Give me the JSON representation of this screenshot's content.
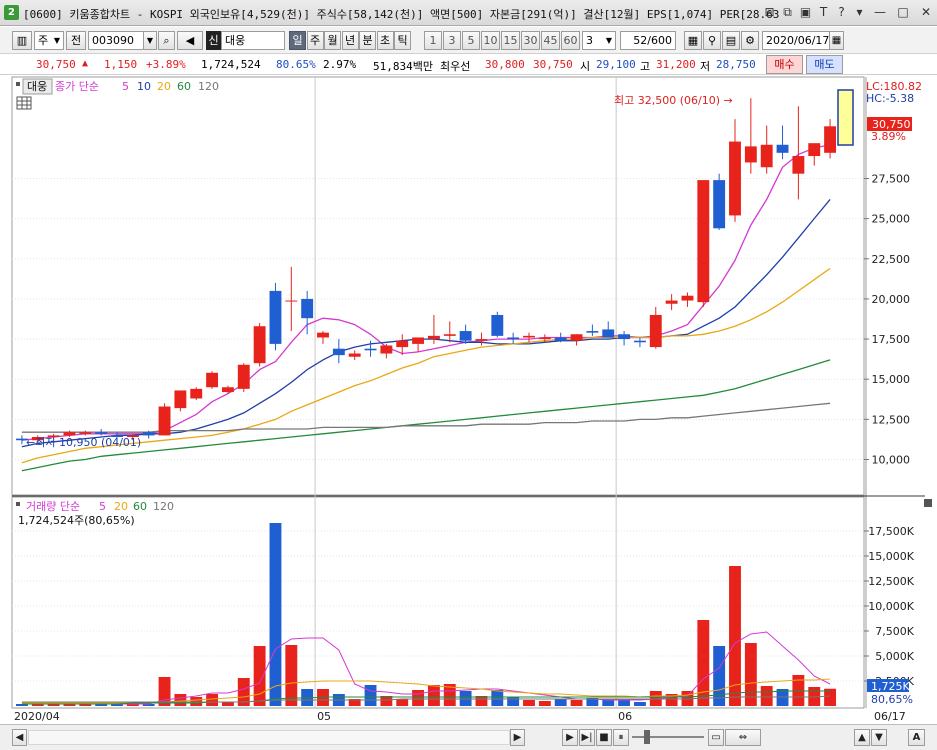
{
  "window": {
    "badge": "2",
    "title": "[0600] 키움종합차트 - KOSPI 외국인보유[4,529(천)] 주식수[58,142(천)] 액면[500] 자본금[291(억)] 결산[12월] EPS[1,074] PER[28.63",
    "icons": [
      "restore-icon",
      "pin-icon",
      "save-icon",
      "font-icon",
      "help-icon",
      "menu-icon",
      "minimize-icon",
      "maximize-icon",
      "close-icon"
    ],
    "glyphs": [
      "⊟",
      "⧉",
      "▣",
      "T",
      "?",
      "▾",
      "—",
      "□",
      "✕"
    ]
  },
  "toolbar": {
    "layout_icon": "▥",
    "type": "주",
    "period_button": "전",
    "code": "003090",
    "search_icon": "⌕",
    "sound_icon": "◀",
    "credit_badge": "신",
    "name": "대웅",
    "intervals": [
      "일",
      "주",
      "월",
      "년",
      "분",
      "초",
      "틱"
    ],
    "selected_interval": "일",
    "numbers": [
      "1",
      "3",
      "5",
      "10",
      "15",
      "30",
      "45",
      "60"
    ],
    "count": "3",
    "count_arrow": "▼",
    "range": "52",
    "range_total": "/600",
    "tool_icons": [
      "▦",
      "⚲",
      "▤",
      "⚙"
    ],
    "date": "2020/06/17",
    "calendar_icon": "▦"
  },
  "quote": {
    "price": "30,750",
    "arrow": "▲",
    "change": "1,150",
    "pct": "+3.89%",
    "volume": "1,724,524",
    "vol_ratio": "80.65%",
    "turnover": "2.97%",
    "amount": "51,834백만",
    "priority_label": "최우선",
    "ask": "30,800",
    "bid": "30,750",
    "open_label": "시",
    "open": "29,100",
    "high_label": "고",
    "high": "31,200",
    "low_label": "저",
    "low": "28,750",
    "buy": "매수",
    "sell": "매도"
  },
  "colors": {
    "up": "#e8231b",
    "down": "#1f5fd1",
    "ma5": "#d33ad3",
    "ma10": "#1f3fa8",
    "ma20": "#e8a814",
    "ma60": "#228b3c",
    "ma120": "#777777"
  },
  "chart_data": [
    {
      "type": "candlestick",
      "legend": {
        "stock": "대웅",
        "indicator": "종가 단순",
        "periods": [
          "5",
          "10",
          "20",
          "60",
          "120"
        ]
      },
      "ymin": 8500,
      "ymax": 18500,
      "yticks": [
        10000,
        12500,
        15000,
        17500,
        20000,
        22500,
        25000,
        27500
      ],
      "ytick_labels": [
        "10,000",
        "12,500",
        "15,000",
        "17,500",
        "20,000",
        "22,500",
        "25,000",
        "27,500"
      ],
      "lc_label": "LC:180.82",
      "hc_label": "HC:-5.38",
      "current_label": "30,750",
      "current_pct": "3.89%",
      "max_annotation": "최고 32,500 (06/10) →",
      "min_annotation": "←최저 10,950 (04/01)",
      "x_labels": [
        "2020/04",
        "05",
        "06",
        "06/17"
      ],
      "candles": [
        [
          11300,
          11500,
          10950,
          11200
        ],
        [
          11200,
          11500,
          11000,
          11400
        ],
        [
          11400,
          11600,
          11300,
          11500
        ],
        [
          11500,
          11800,
          11400,
          11700
        ],
        [
          11600,
          11800,
          11500,
          11700
        ],
        [
          11700,
          11900,
          11500,
          11600
        ],
        [
          11500,
          11700,
          11300,
          11400
        ],
        [
          11400,
          11600,
          11200,
          11500
        ],
        [
          11700,
          11800,
          11300,
          11500
        ],
        [
          11500,
          13500,
          11500,
          13300
        ],
        [
          13200,
          14200,
          13000,
          14300
        ],
        [
          13800,
          14500,
          13700,
          14400
        ],
        [
          14500,
          15500,
          14400,
          15400
        ],
        [
          14200,
          14600,
          14100,
          14500
        ],
        [
          14400,
          16000,
          14200,
          15900
        ],
        [
          16000,
          18500,
          15800,
          18300
        ],
        [
          20500,
          21000,
          16800,
          17200
        ],
        [
          19900,
          22000,
          18000,
          19900
        ],
        [
          20000,
          20500,
          17800,
          18800
        ],
        [
          17600,
          18000,
          17200,
          17900
        ],
        [
          16900,
          17500,
          16000,
          16500
        ],
        [
          16400,
          16800,
          16200,
          16600
        ],
        [
          16900,
          17400,
          16400,
          16800
        ],
        [
          16600,
          17200,
          16300,
          17100
        ],
        [
          17000,
          17800,
          16500,
          17400
        ],
        [
          17200,
          17600,
          16700,
          17600
        ],
        [
          17500,
          19000,
          17200,
          17700
        ],
        [
          17700,
          18600,
          17300,
          17800
        ],
        [
          18000,
          18400,
          17200,
          17400
        ],
        [
          17400,
          17900,
          17100,
          17500
        ],
        [
          19000,
          19200,
          17600,
          17700
        ],
        [
          17600,
          17900,
          17200,
          17500
        ],
        [
          17600,
          17900,
          17300,
          17700
        ],
        [
          17500,
          17800,
          17300,
          17600
        ],
        [
          17600,
          17900,
          17300,
          17400
        ],
        [
          17400,
          17800,
          17100,
          17800
        ],
        [
          18000,
          18400,
          17700,
          17900
        ],
        [
          18100,
          18600,
          17700,
          17600
        ],
        [
          17800,
          18000,
          17100,
          17500
        ],
        [
          17400,
          17600,
          17000,
          17300
        ],
        [
          17000,
          19500,
          16900,
          19000
        ],
        [
          19700,
          20300,
          19300,
          19900
        ],
        [
          19900,
          20400,
          19500,
          20200
        ],
        [
          19800,
          26800,
          19500,
          27400
        ],
        [
          27400,
          27800,
          24300,
          24400
        ],
        [
          25200,
          31200,
          24800,
          29800
        ],
        [
          28500,
          32500,
          27800,
          29500
        ],
        [
          28200,
          30800,
          27800,
          29600
        ],
        [
          29600,
          30800,
          28700,
          29100
        ],
        [
          27800,
          32000,
          26200,
          28900
        ],
        [
          28900,
          29600,
          28300,
          29700
        ],
        [
          29100,
          31200,
          28750,
          30750
        ]
      ],
      "series": [
        {
          "name": "5",
          "color": "#d33ad3",
          "values": [
            11200,
            11300,
            11400,
            11500,
            11600,
            11600,
            11600,
            11600,
            11600,
            11800,
            12300,
            12800,
            13600,
            14100,
            14700,
            15600,
            16100,
            17300,
            18400,
            18800,
            18700,
            18400,
            17800,
            17000,
            16600,
            16700,
            16900,
            17100,
            17300,
            17400,
            17500,
            17500,
            17500,
            17600,
            17600,
            17600,
            17600,
            17700,
            17700,
            17600,
            17700,
            18000,
            18400,
            19600,
            20800,
            22400,
            24600,
            26200,
            28200,
            29000,
            29400,
            29600
          ]
        },
        {
          "name": "10",
          "color": "#1f3fa8",
          "values": [
            10800,
            11000,
            11100,
            11200,
            11300,
            11400,
            11500,
            11500,
            11600,
            11600,
            11700,
            11900,
            12200,
            12500,
            12900,
            13500,
            14100,
            14800,
            15600,
            16200,
            16700,
            17000,
            17200,
            17300,
            17400,
            17500,
            17500,
            17400,
            17300,
            17300,
            17200,
            17200,
            17200,
            17300,
            17400,
            17400,
            17500,
            17500,
            17600,
            17600,
            17600,
            17700,
            17800,
            18300,
            18800,
            19500,
            20500,
            21500,
            22600,
            23800,
            25000,
            26200
          ]
        },
        {
          "name": "20",
          "color": "#e8a814",
          "values": [
            9800,
            10100,
            10300,
            10500,
            10700,
            10800,
            10900,
            11000,
            11100,
            11200,
            11300,
            11400,
            11500,
            11700,
            11900,
            12200,
            12500,
            13000,
            13400,
            13800,
            14200,
            14600,
            14900,
            15300,
            15700,
            16000,
            16400,
            16600,
            16800,
            17000,
            17100,
            17200,
            17300,
            17400,
            17500,
            17500,
            17600,
            17600,
            17600,
            17600,
            17600,
            17700,
            17700,
            17800,
            18000,
            18300,
            18700,
            19200,
            19800,
            20500,
            21200,
            21900
          ]
        },
        {
          "name": "60",
          "color": "#228b3c",
          "values": [
            9300,
            9500,
            9700,
            9900,
            10000,
            10200,
            10300,
            10400,
            10500,
            10600,
            10700,
            10800,
            10900,
            11000,
            11100,
            11200,
            11300,
            11400,
            11500,
            11600,
            11700,
            11800,
            11900,
            12000,
            12100,
            12200,
            12300,
            12400,
            12500,
            12600,
            12700,
            12800,
            12900,
            13000,
            13100,
            13200,
            13300,
            13400,
            13500,
            13600,
            13700,
            13800,
            13900,
            14000,
            14200,
            14400,
            14700,
            15000,
            15300,
            15600,
            15900,
            16200
          ]
        },
        {
          "name": "120",
          "color": "#777777",
          "values": [
            11700,
            11700,
            11700,
            11700,
            11700,
            11700,
            11700,
            11700,
            11700,
            11800,
            11800,
            11800,
            11800,
            11800,
            11900,
            11900,
            11900,
            11900,
            11900,
            12000,
            12000,
            12000,
            12000,
            12000,
            12100,
            12100,
            12100,
            12100,
            12100,
            12200,
            12200,
            12200,
            12200,
            12300,
            12300,
            12300,
            12400,
            12400,
            12400,
            12500,
            12500,
            12600,
            12600,
            12700,
            12800,
            12900,
            13000,
            13100,
            13200,
            13300,
            13400,
            13500
          ]
        }
      ]
    },
    {
      "type": "bar",
      "legend": {
        "indicator": "거래량 단순",
        "periods": [
          "5",
          "20",
          "60",
          "120"
        ]
      },
      "volume_label": "1,724,524주(80,65%)",
      "ymin": 0,
      "ymax": 19000,
      "yticks": [
        2500,
        5000,
        7500,
        10000,
        12500,
        15000,
        17500
      ],
      "ytick_labels": [
        "2,500K",
        "5,000K",
        "7,500K",
        "10,000K",
        "12,500K",
        "15,000K",
        "17,500K"
      ],
      "current_label": "1,725K",
      "current_pct": "80,65%",
      "values": [
        200,
        200,
        200,
        200,
        200,
        200,
        200,
        200,
        200,
        2900,
        1200,
        900,
        1200,
        400,
        2800,
        6000,
        18300,
        6100,
        1700,
        1700,
        1200,
        700,
        2100,
        1000,
        700,
        1600,
        2100,
        2200,
        1500,
        1000,
        1600,
        900,
        600,
        500,
        700,
        600,
        800,
        700,
        600,
        400,
        1500,
        1200,
        1500,
        8600,
        6000,
        14000,
        6300,
        2000,
        1700,
        3100,
        1900,
        1725
      ],
      "series": [
        {
          "name": "5",
          "color": "#d33ad3",
          "values": [
            200,
            200,
            200,
            200,
            200,
            200,
            200,
            200,
            200,
            600,
            800,
            1000,
            1300,
            1300,
            1700,
            2300,
            5700,
            6700,
            6800,
            6800,
            5600,
            2200,
            1500,
            1400,
            1200,
            1200,
            1500,
            1500,
            1600,
            1700,
            1700,
            1500,
            1300,
            1100,
            900,
            700,
            700,
            600,
            600,
            600,
            700,
            900,
            1000,
            2700,
            3800,
            6300,
            7200,
            7400,
            6000,
            4600,
            3000,
            2200
          ]
        },
        {
          "name": "20",
          "color": "#e8a814",
          "values": [
            300,
            300,
            300,
            300,
            300,
            300,
            300,
            300,
            300,
            400,
            500,
            600,
            700,
            800,
            900,
            1200,
            2000,
            2300,
            2400,
            2500,
            2500,
            2500,
            2500,
            2400,
            2300,
            2200,
            2000,
            1900,
            1800,
            1700,
            1500,
            1400,
            1300,
            1200,
            1200,
            1100,
            1000,
            1000,
            1000,
            900,
            1000,
            1000,
            1100,
            1400,
            1600,
            2100,
            2300,
            2400,
            2500,
            2600,
            2600,
            2700
          ]
        },
        {
          "name": "60",
          "color": "#228b3c",
          "values": [
            200,
            200,
            200,
            200,
            200,
            200,
            200,
            300,
            300,
            300,
            300,
            300,
            400,
            400,
            400,
            500,
            700,
            800,
            800,
            900,
            900,
            900,
            900,
            900,
            900,
            900,
            900,
            900,
            900,
            900,
            900,
            900,
            900,
            900,
            900,
            900,
            900,
            900,
            900,
            900,
            900,
            900,
            900,
            1000,
            1100,
            1300,
            1400,
            1400,
            1500,
            1500,
            1500,
            1500
          ]
        },
        {
          "name": "120",
          "color": "#777777",
          "values": [
            400,
            400,
            400,
            400,
            400,
            400,
            400,
            400,
            400,
            400,
            400,
            400,
            400,
            400,
            400,
            500,
            600,
            600,
            600,
            600,
            600,
            600,
            600,
            600,
            700,
            700,
            700,
            700,
            700,
            700,
            700,
            700,
            700,
            700,
            700,
            700,
            700,
            700,
            700,
            700,
            700,
            700,
            700,
            800,
            800,
            900,
            900,
            900,
            900,
            900,
            900,
            1000
          ]
        }
      ]
    }
  ],
  "status": {
    "buttons": [
      "◀",
      "▶",
      "▶|",
      "■",
      "⏸",
      "▭",
      "⇔",
      "▲",
      "▼",
      "A"
    ]
  }
}
